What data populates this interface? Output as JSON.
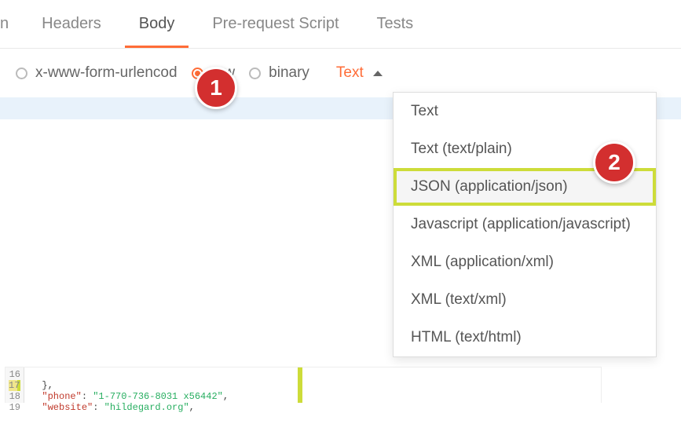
{
  "tabs": {
    "partial": "n",
    "headers": "Headers",
    "body": "Body",
    "prerequest": "Pre-request Script",
    "tests": "Tests"
  },
  "bodyTypes": {
    "urlencoded": "x-www-form-urlencod",
    "raw": "raw",
    "binary": "binary"
  },
  "typeSelector": "Text",
  "dropdown": {
    "text": "Text",
    "textplain": "Text (text/plain)",
    "json": "JSON (application/json)",
    "javascript": "Javascript (application/javascript)",
    "xmlapp": "XML (application/xml)",
    "xmltext": "XML (text/xml)",
    "html": "HTML (text/html)"
  },
  "badges": {
    "b1": "1",
    "b2": "2"
  },
  "code": {
    "ln16": "16",
    "ln17": "17",
    "ln18": "18",
    "ln19": "19",
    "line16": "  },",
    "phoneKey": "\"phone\"",
    "phoneVal": "\"1-770-736-8031 x56442\"",
    "webKey": "\"website\"",
    "webVal": "\"hildegard.org\""
  }
}
